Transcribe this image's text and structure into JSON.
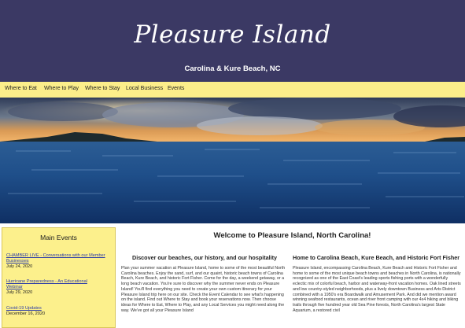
{
  "header": {
    "title": "Pleasure Island",
    "subtitle": "Carolina & Kure Beach, NC"
  },
  "nav": {
    "items": [
      "Where to Eat",
      "Where to Play",
      "Where to Stay",
      "Local Business",
      "Events"
    ]
  },
  "sidebar": {
    "title": "Main Events",
    "events": [
      {
        "link": "CHAMBER LIVE - Conversations with our Member Businesses",
        "date": "July 24, 2020"
      },
      {
        "link": "Hurricane Preparedness - An Educational Webinar",
        "date": "July 29, 2020"
      },
      {
        "link": "Covid-19 Updates",
        "date": "December 16, 2020"
      }
    ]
  },
  "main": {
    "heading": "Welcome to Pleasure Island, North Carolina!",
    "left_heading": "Discover our beaches, our history, and our hospitality",
    "left_text": "Plan your summer vacation at Pleasure Island, home to some of the most beautiful North Carolina beaches. Enjoy the sand, surf, and our quaint, historic beach towns of Carolina Beach, Kure Beach, and historic Fort Fisher. Come for the day, a weekend getaway, or a long beach vacation. You're sure to discover why the summer never ends on Pleasure Island! You'll find everything you need to create your own custom itinerary for your Pleasure Island trip here on our site. Check the Event Calendar to see what's happening on the island. Find out Where to Stay and book your reservations now. Then choose ideas for Where to Eat, Where to Play, and any Local Services you might need along the way. We've got all your Pleasure Island",
    "right_heading": "Home to Carolina Beach, Kure Beach, and Historic Fort Fisher",
    "right_text": "Pleasure Island, encompassing Carolina Beach, Kure Beach and Historic Fort Fisher and home to some of the most unique beach towns and beaches in North Carolina, is nationally recognized as one of the East Coast's leading sports fishing ports with a wonderfully eclectic mix of colorful beach, harbor and waterway-front vacation homes. Oak lined streets and low country-styled neighborhoods, plus a lively downtown Business and Arts District combined with a 1950's era Boardwalk and Amusement Park. And did we mention award winning seafood restaurants, ocean and river front camping with our 4x4 hiking and biking trails through five hundred year old Sea Pine forests, North Carolina's largest State Aquarium, a restored civil"
  }
}
